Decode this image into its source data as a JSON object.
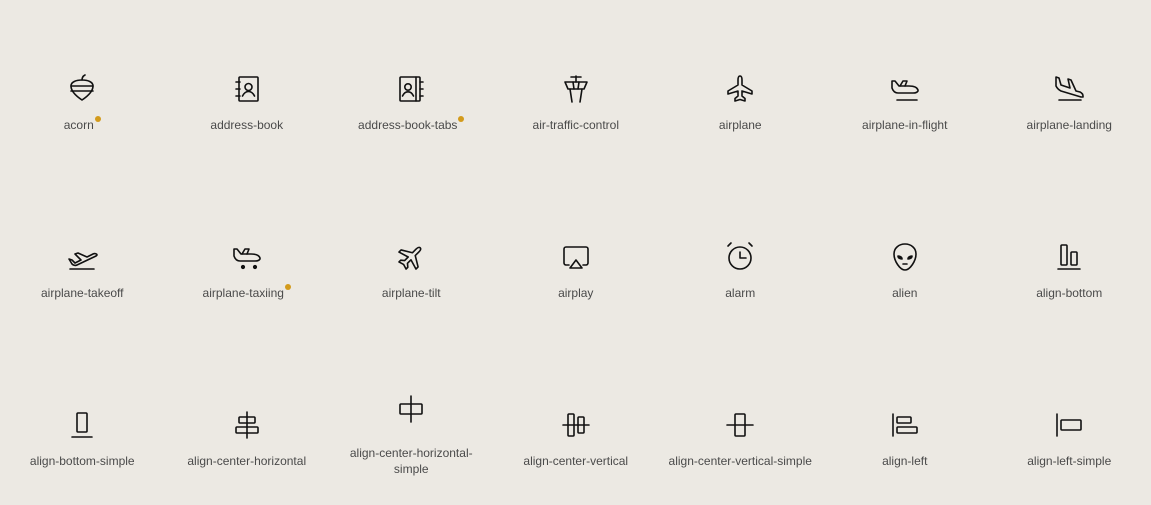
{
  "badge_color": "#d39b1c",
  "icons": [
    {
      "label": "acorn",
      "icon": "acorn-icon",
      "badge": true
    },
    {
      "label": "address-book",
      "icon": "address-book-icon",
      "badge": false
    },
    {
      "label": "address-book-tabs",
      "icon": "address-book-tabs-icon",
      "badge": true
    },
    {
      "label": "air-traffic-control",
      "icon": "air-traffic-control-icon",
      "badge": false
    },
    {
      "label": "airplane",
      "icon": "airplane-icon",
      "badge": false
    },
    {
      "label": "airplane-in-flight",
      "icon": "airplane-in-flight-icon",
      "badge": false
    },
    {
      "label": "airplane-landing",
      "icon": "airplane-landing-icon",
      "badge": false
    },
    {
      "label": "airplane-takeoff",
      "icon": "airplane-takeoff-icon",
      "badge": false
    },
    {
      "label": "airplane-taxiing",
      "icon": "airplane-taxiing-icon",
      "badge": true
    },
    {
      "label": "airplane-tilt",
      "icon": "airplane-tilt-icon",
      "badge": false
    },
    {
      "label": "airplay",
      "icon": "airplay-icon",
      "badge": false
    },
    {
      "label": "alarm",
      "icon": "alarm-icon",
      "badge": false
    },
    {
      "label": "alien",
      "icon": "alien-icon",
      "badge": false
    },
    {
      "label": "align-bottom",
      "icon": "align-bottom-icon",
      "badge": false
    },
    {
      "label": "align-bottom-simple",
      "icon": "align-bottom-simple-icon",
      "badge": false
    },
    {
      "label": "align-center-horizontal",
      "icon": "align-center-horizontal-icon",
      "badge": false
    },
    {
      "label": "align-center-horizontal-simple",
      "icon": "align-center-horizontal-simple-icon",
      "badge": false
    },
    {
      "label": "align-center-vertical",
      "icon": "align-center-vertical-icon",
      "badge": false
    },
    {
      "label": "align-center-vertical-simple",
      "icon": "align-center-vertical-simple-icon",
      "badge": false
    },
    {
      "label": "align-left",
      "icon": "align-left-icon",
      "badge": false
    },
    {
      "label": "align-left-simple",
      "icon": "align-left-simple-icon",
      "badge": false
    }
  ]
}
